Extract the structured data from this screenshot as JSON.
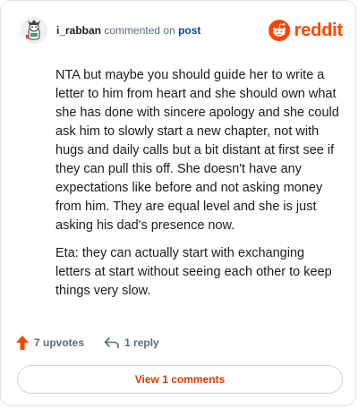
{
  "header": {
    "username": "i_rabban",
    "action_text": "commented on",
    "target_text": "post",
    "brand": "reddit"
  },
  "comment": {
    "paragraphs": [
      "NTA but maybe you should guide her to write a letter to him from heart and she should own what she has done with sincere apology and she could ask him to slowly start a new chapter, not with hugs and daily calls but a bit distant at first see if they can pull this off. She doesn't have any expectations like before and not asking money from him. They are equal level and she is just asking his dad's presence now.",
      "Eta: they can actually start with exchanging letters at start without seeing each other to keep things very slow."
    ]
  },
  "actions": {
    "upvotes_label": "7 upvotes",
    "reply_label": "1 reply"
  },
  "view_comments_label": "View 1 comments",
  "colors": {
    "brand": "#ff4500",
    "link": "#0a449b",
    "button_text": "#d93a00",
    "muted": "#576f76"
  },
  "icons": {
    "avatar": "avatar-icon",
    "brand_logo": "reddit-logo-icon",
    "upvote": "upvote-arrow-icon",
    "reply": "reply-arrow-icon"
  }
}
